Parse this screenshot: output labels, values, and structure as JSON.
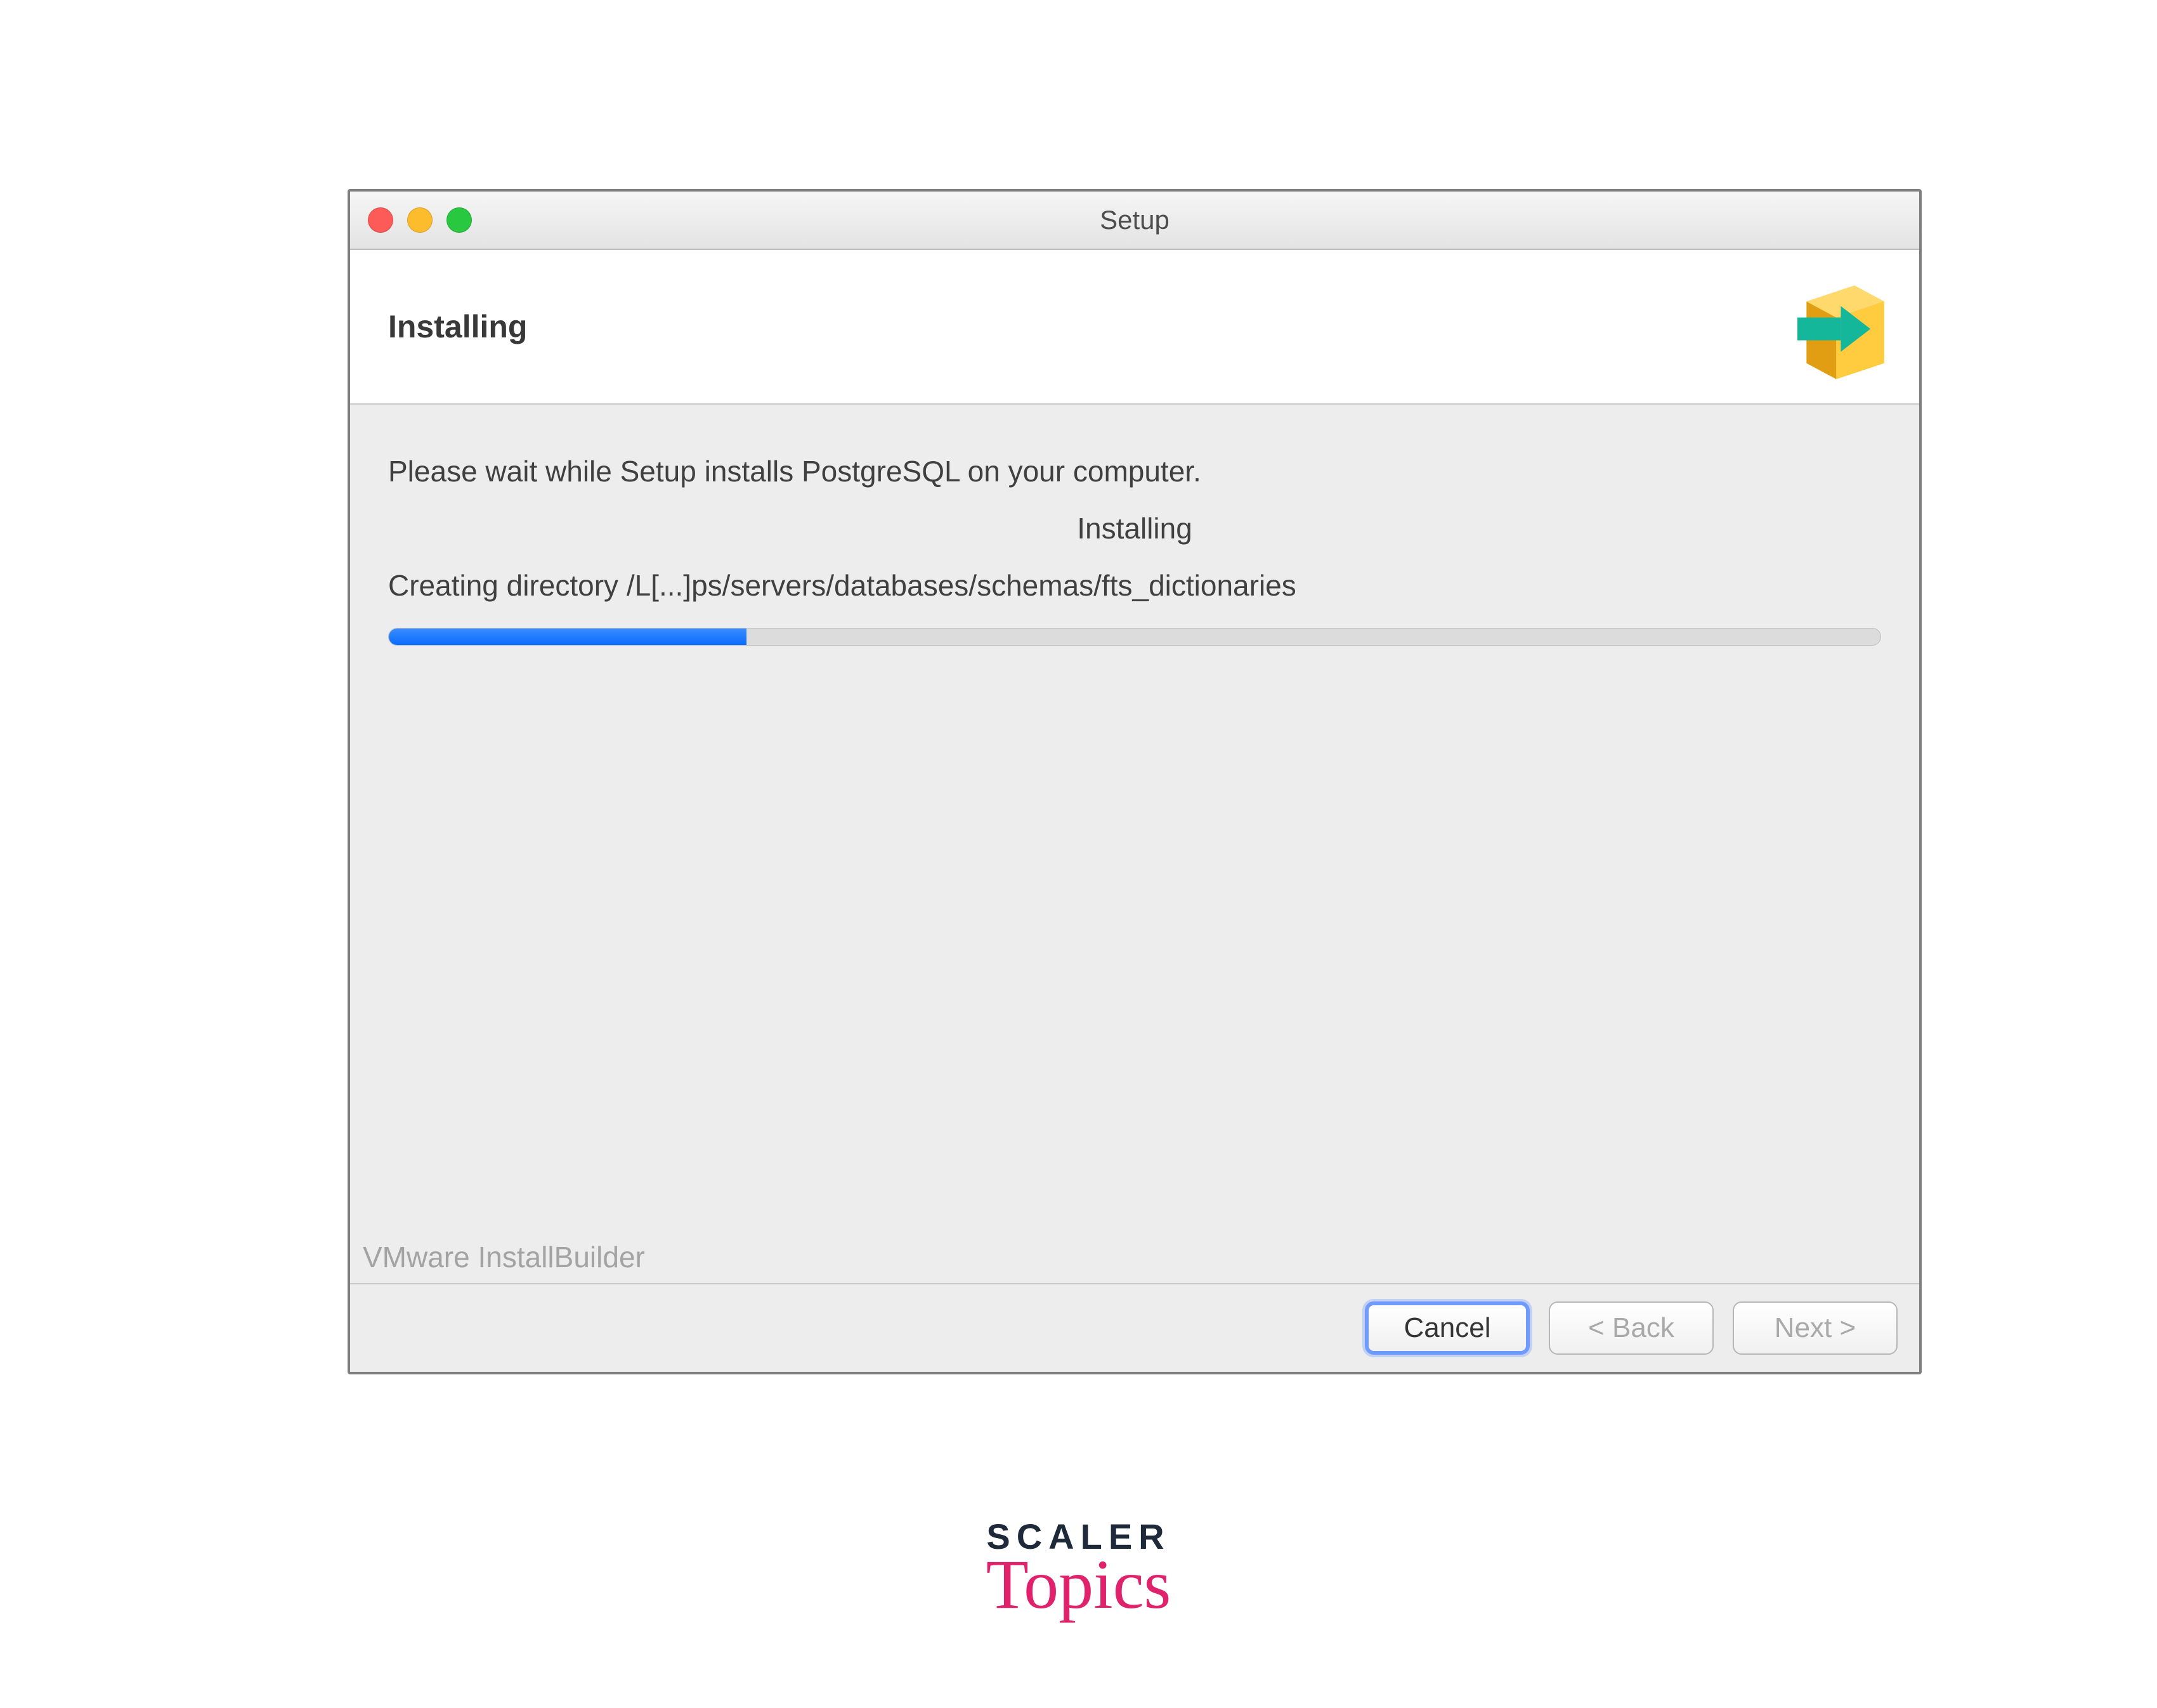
{
  "window": {
    "title": "Setup"
  },
  "header": {
    "title": "Installing"
  },
  "body": {
    "message": "Please wait while Setup installs PostgreSQL on your computer.",
    "stage_label": "Installing",
    "status": "Creating directory /L[...]ps/servers/databases/schemas/fts_dictionaries",
    "progress_percent": 24
  },
  "vendor": "VMware InstallBuilder",
  "footer": {
    "cancel": "Cancel",
    "back": "< Back",
    "next": "Next >"
  },
  "watermark": {
    "line1": "SCALER",
    "line2": "Topics"
  },
  "icons": {
    "header": "package-arrow-icon"
  }
}
